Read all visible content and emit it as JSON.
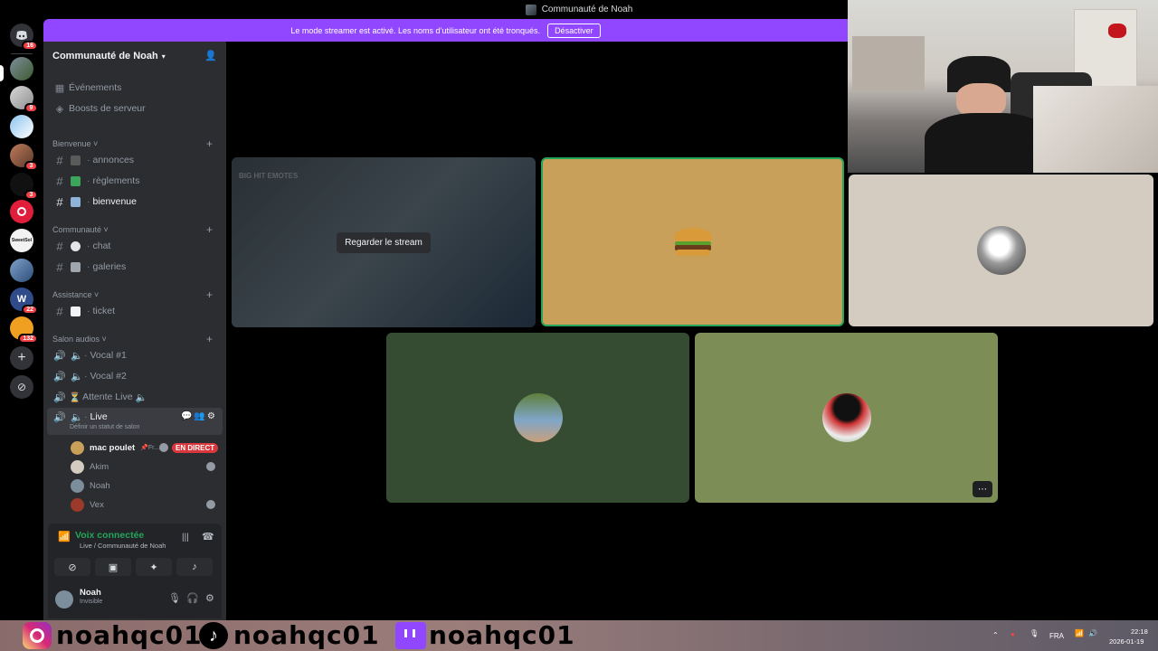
{
  "window": {
    "title": "Communauté de Noah"
  },
  "banner": {
    "text": "Le mode streamer est activé. Les noms d’utilisateur ont été tronqués.",
    "button": "Désactiver"
  },
  "rail": {
    "badges": [
      "16",
      "9",
      "3",
      "3",
      "22",
      "132"
    ],
    "icons": [
      "discord-logo-icon",
      "add-server-icon",
      "discover-icon"
    ]
  },
  "sidebar": {
    "guild_name": "Communauté de Noah",
    "top_items": [
      "Événements",
      "Boosts de serveur"
    ],
    "categories": [
      "Bienvenue",
      "Communauté",
      "Assistance",
      "Salon audios"
    ],
    "channels": {
      "annonces": "annonces",
      "reglements": "règlements",
      "bienvenue": "bienvenue",
      "chat": "chat",
      "galeries": "galeries",
      "ticket": "ticket"
    },
    "voice": [
      "Vocal #1",
      "Vocal #2",
      "Attente Live",
      "Live"
    ],
    "live_status_placeholder": "Définir un statut de salon",
    "members": [
      {
        "name": "mac poulet",
        "extra": "Fr...",
        "badge": "EN DIRECT"
      },
      {
        "name": "Akim"
      },
      {
        "name": "Noah"
      },
      {
        "name": "Vex"
      }
    ]
  },
  "voice_panel": {
    "title": "Voix connectée",
    "subtitle": "Live / Communauté de Noah"
  },
  "user": {
    "name": "Noah",
    "status": "Invisible"
  },
  "stage": {
    "watch_stream": "Regarder le stream",
    "stream_preview_title": "BIG HIT EMOTES"
  },
  "taskbar": {
    "overlay_handles": [
      "noahqc01",
      "noahqc01",
      "noahqc01"
    ],
    "language": "FRA",
    "time": "22:18",
    "date": "2026-01-19"
  },
  "colors": {
    "banner": "#9147ff",
    "sidebar": "#2b2d31",
    "live_badge": "#da373c",
    "voice_connected": "#23a55a",
    "tile_burger": "#c9a05a",
    "tile_cat": "#d4cbc1",
    "tile_green_dark": "#354c32",
    "tile_green_light": "#7c8e55"
  }
}
